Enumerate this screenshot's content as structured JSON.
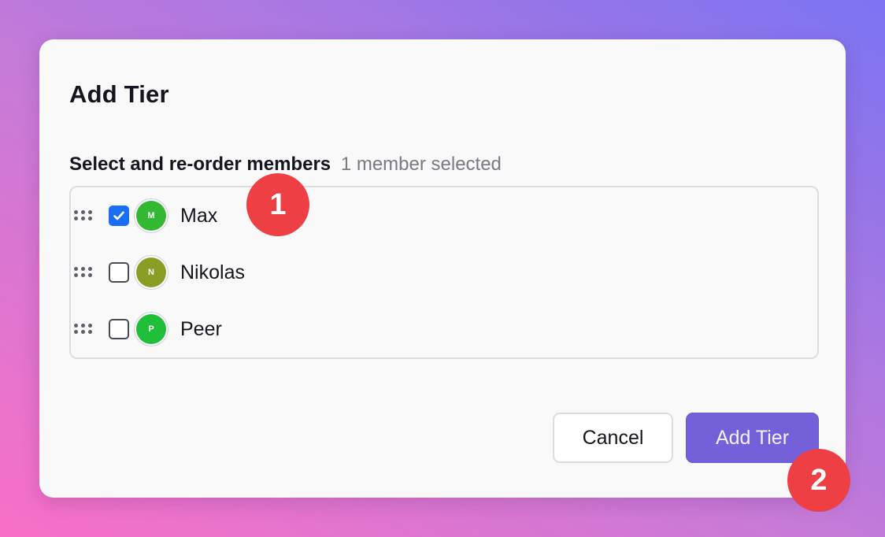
{
  "dialog": {
    "title": "Add Tier",
    "section_label": "Select and re-order members",
    "selection_count": "1 member selected",
    "members": [
      {
        "name": "Max",
        "initial": "M",
        "checked": true,
        "avatar_color": "#33b832"
      },
      {
        "name": "Nikolas",
        "initial": "N",
        "checked": false,
        "avatar_color": "#8a9e26"
      },
      {
        "name": "Peer",
        "initial": "P",
        "checked": false,
        "avatar_color": "#1fbf3a"
      }
    ],
    "cancel_label": "Cancel",
    "submit_label": "Add Tier"
  },
  "callouts": [
    "1",
    "2"
  ],
  "colors": {
    "accent": "#7460d8",
    "checkbox_checked": "#1a6ef5",
    "callout": "#ee3f45"
  },
  "icons": {
    "drag_handle": "drag-handle-icon",
    "checkmark": "checkmark-icon"
  }
}
